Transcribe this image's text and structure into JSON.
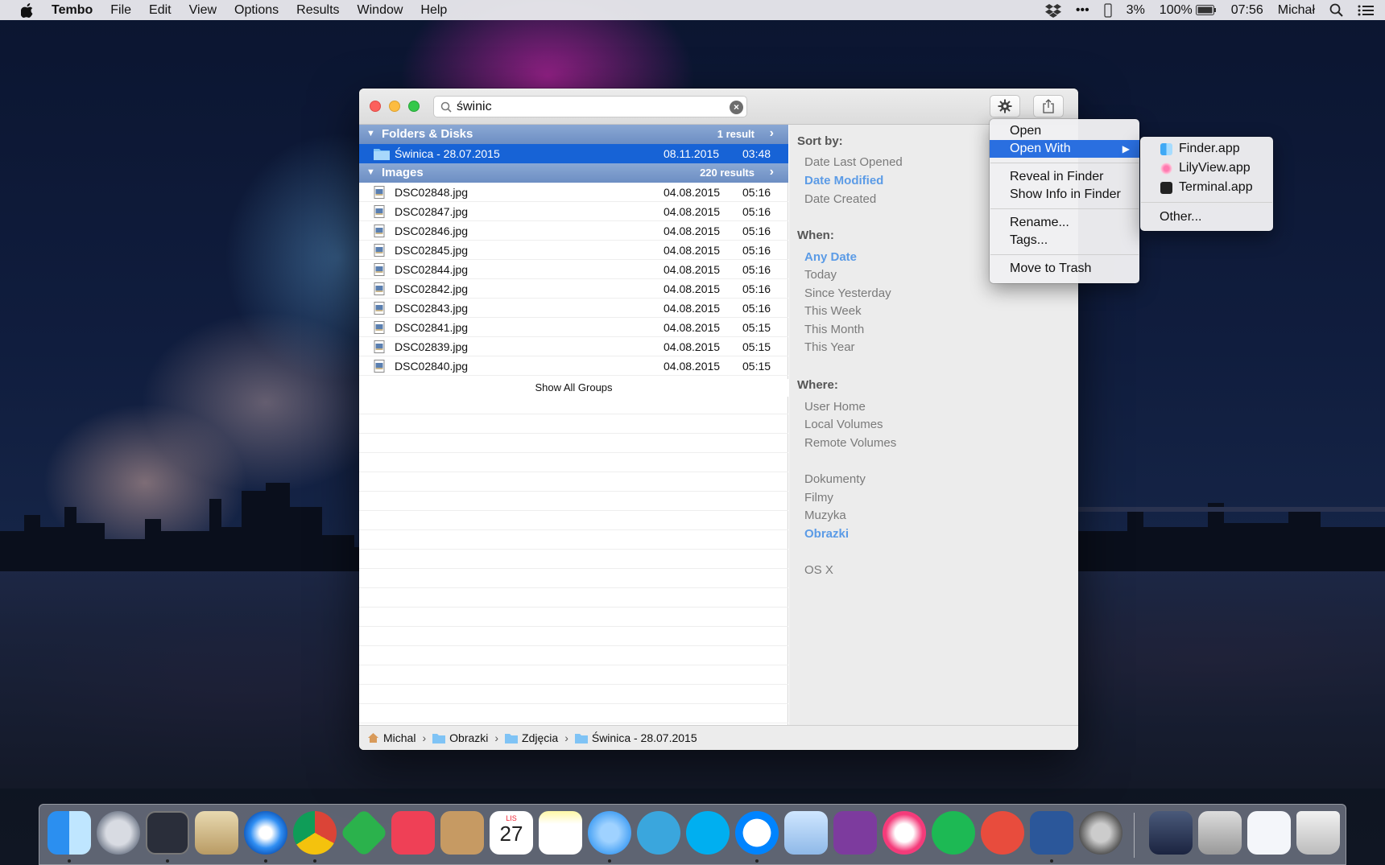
{
  "menubar": {
    "app_name": "Tembo",
    "items": [
      "File",
      "Edit",
      "View",
      "Options",
      "Results",
      "Window",
      "Help"
    ],
    "status": {
      "more": "•••",
      "battery_pct_left": "3%",
      "battery_pct": "100%",
      "time": "07:56",
      "user": "Michał"
    }
  },
  "search": {
    "value": "świnic"
  },
  "groups": [
    {
      "name": "Folders & Disks",
      "count": "1 result"
    },
    {
      "name": "Images",
      "count": "220 results"
    }
  ],
  "folders": [
    {
      "name": "Świnica - 28.07.2015",
      "date": "08.11.2015",
      "time": "03:48"
    }
  ],
  "images": [
    {
      "name": "DSC02848.jpg",
      "date": "04.08.2015",
      "time": "05:16"
    },
    {
      "name": "DSC02847.jpg",
      "date": "04.08.2015",
      "time": "05:16"
    },
    {
      "name": "DSC02846.jpg",
      "date": "04.08.2015",
      "time": "05:16"
    },
    {
      "name": "DSC02845.jpg",
      "date": "04.08.2015",
      "time": "05:16"
    },
    {
      "name": "DSC02844.jpg",
      "date": "04.08.2015",
      "time": "05:16"
    },
    {
      "name": "DSC02842.jpg",
      "date": "04.08.2015",
      "time": "05:16"
    },
    {
      "name": "DSC02843.jpg",
      "date": "04.08.2015",
      "time": "05:16"
    },
    {
      "name": "DSC02841.jpg",
      "date": "04.08.2015",
      "time": "05:15"
    },
    {
      "name": "DSC02839.jpg",
      "date": "04.08.2015",
      "time": "05:15"
    },
    {
      "name": "DSC02840.jpg",
      "date": "04.08.2015",
      "time": "05:15"
    }
  ],
  "show_all": "Show All Groups",
  "filters": {
    "sort_by": {
      "heading": "Sort by:",
      "items": [
        "Date Last Opened",
        "Date Modified",
        "Date Created"
      ],
      "active": "Date Modified"
    },
    "when": {
      "heading": "When:",
      "items": [
        "Any Date",
        "Today",
        "Since Yesterday",
        "This Week",
        "This Month",
        "This Year"
      ],
      "active": "Any Date"
    },
    "where": {
      "heading": "Where:",
      "items": [
        "User Home",
        "Local Volumes",
        "Remote Volumes",
        "Dokumenty",
        "Filmy",
        "Muzyka",
        "Obrazki",
        "OS X"
      ],
      "active": "Obrazki"
    }
  },
  "path": [
    "Michal",
    "Obrazki",
    "Zdjęcia",
    "Świnica - 28.07.2015"
  ],
  "context_menu": {
    "items": [
      "Open",
      "Open With",
      "Reveal in Finder",
      "Show Info in Finder",
      "Rename...",
      "Tags...",
      "Move to Trash"
    ],
    "highlighted": "Open With"
  },
  "submenu": {
    "apps": [
      "Finder.app",
      "LilyView.app",
      "Terminal.app"
    ],
    "other": "Other..."
  },
  "dock": {
    "apps": [
      "finder-icon",
      "launchpad-icon",
      "activity-monitor-icon",
      "mail-icon",
      "safari-icon",
      "chrome-icon",
      "feedly-icon",
      "pocket-icon",
      "contacts-icon",
      "calendar-icon",
      "notes-icon",
      "messages-icon",
      "telegram-icon",
      "skype-icon",
      "messenger-icon",
      "preview-icon",
      "onenote-icon",
      "itunes-icon",
      "spotify-icon",
      "transmit-icon",
      "word-icon",
      "screenshot-icon"
    ],
    "calendar": {
      "month": "LIS",
      "day": "27"
    }
  },
  "colors": {
    "selection": "#1763d6",
    "group_header": "#7b9bcc",
    "active_filter": "#5b9be6",
    "menu_highlight": "#2a6fe0"
  }
}
